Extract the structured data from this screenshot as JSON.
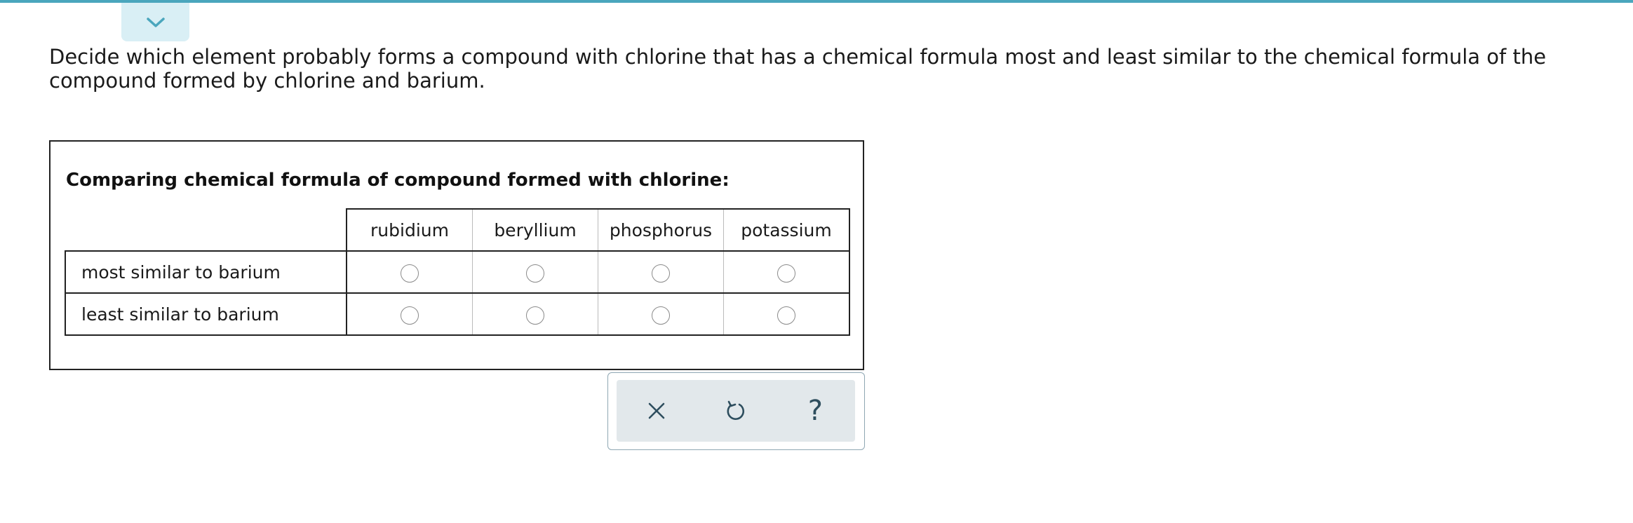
{
  "prompt": {
    "text": "Decide which element probably forms a compound with chlorine that has a chemical formula most and least similar to the chemical formula of the compound formed by chlorine and barium."
  },
  "collapse_toggle": {
    "icon": "chevron-down-icon"
  },
  "panel": {
    "title": "Comparing chemical formula of compound formed with chlorine:",
    "columns": [
      "rubidium",
      "beryllium",
      "phosphorus",
      "potassium"
    ],
    "rows": [
      {
        "label": "most similar to barium",
        "selected": null
      },
      {
        "label": "least similar to barium",
        "selected": null
      }
    ]
  },
  "toolbar": {
    "buttons": [
      {
        "name": "clear",
        "icon": "close-icon"
      },
      {
        "name": "undo",
        "icon": "undo-icon"
      },
      {
        "name": "help",
        "icon": "help-icon",
        "label": "?"
      }
    ]
  },
  "colors": {
    "accent": "#4aa6bd",
    "tab_background": "#d9eff5",
    "toolbar_background": "#e2e8eb",
    "icon": "#2e4e5e"
  }
}
